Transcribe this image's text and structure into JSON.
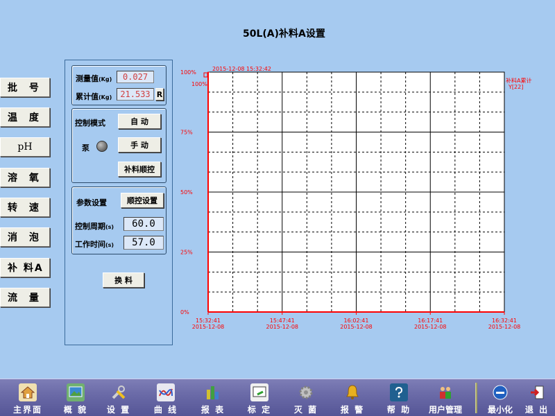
{
  "title": "50L(A)补料A设置",
  "nav": [
    {
      "label": "批 号"
    },
    {
      "label": "温 度"
    },
    {
      "label": "pH"
    },
    {
      "label": "溶 氧"
    },
    {
      "label": "转 速"
    },
    {
      "label": "消 泡"
    },
    {
      "label": "补 料A"
    },
    {
      "label": "流 量"
    }
  ],
  "measure": {
    "measured_label": "测量值",
    "measured_unit": "(Kg)",
    "measured_value": "0.027",
    "cumulative_label": "累计值",
    "cumulative_unit": "(Kg)",
    "cumulative_value": "21.533",
    "reset_label": "R"
  },
  "control": {
    "mode_label": "控制模式",
    "auto_label": "自 动",
    "manual_label": "手 动",
    "pump_label": "泵",
    "feed_seq_label": "补料顺控"
  },
  "params": {
    "label": "参数设置",
    "seq_setup_label": "顺控设置",
    "period_label": "控制周期",
    "period_unit": "(s)",
    "period_value": "60.0",
    "worktime_label": "工作时间",
    "worktime_unit": "(s)",
    "worktime_value": "57.0"
  },
  "swap_label": "换 料",
  "chart_data": {
    "type": "line",
    "timestamp": "2015-12-08 15:32:42",
    "y_ticks": [
      "0%",
      "25%",
      "50%",
      "75%",
      "100%"
    ],
    "y_top_inner": "100%",
    "ylim": [
      0,
      100
    ],
    "x_ticks": [
      {
        "time": "15:32:41",
        "date": "2015-12-08"
      },
      {
        "time": "15:47:41",
        "date": "2015-12-08"
      },
      {
        "time": "16:02:41",
        "date": "2015-12-08"
      },
      {
        "time": "16:17:41",
        "date": "2015-12-08"
      },
      {
        "time": "16:32:41",
        "date": "2015-12-08"
      }
    ],
    "series": [
      {
        "name": "补料A累计",
        "axis": "Y[22]",
        "values": [
          100
        ]
      }
    ],
    "grid": true,
    "colors": {
      "axis": "#ff0000",
      "grid": "#000000",
      "plot_bg": "#ffffff"
    }
  },
  "toolbar": [
    {
      "label": "主界面",
      "icon": "home-icon"
    },
    {
      "label": "概 貌",
      "icon": "overview-icon"
    },
    {
      "label": "设 置",
      "icon": "tools-icon"
    },
    {
      "label": "曲 线",
      "icon": "curve-icon"
    },
    {
      "label": "报 表",
      "icon": "report-icon"
    },
    {
      "label": "标 定",
      "icon": "calibrate-icon"
    },
    {
      "label": "灭 菌",
      "icon": "sterilize-icon"
    },
    {
      "label": "报 警",
      "icon": "alarm-icon"
    },
    {
      "label": "帮 助",
      "icon": "help-icon"
    },
    {
      "label": "用户管理",
      "icon": "users-icon"
    },
    {
      "label": "最小化",
      "icon": "minimize-icon"
    },
    {
      "label": "退 出",
      "icon": "exit-icon"
    }
  ]
}
